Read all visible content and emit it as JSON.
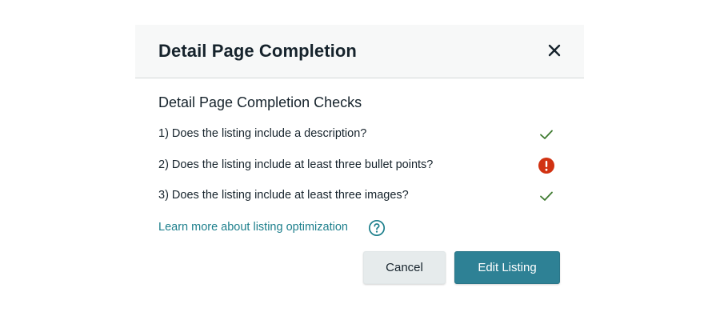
{
  "modal": {
    "title": "Detail Page Completion",
    "close_icon": "close-icon",
    "section_heading": "Detail Page Completion Checks",
    "checks": [
      {
        "label": "1) Does the listing include a description?",
        "status": "pass",
        "icon": "checkmark-icon",
        "color": "#3d7a2f"
      },
      {
        "label": "2) Does the listing include at least three bullet points?",
        "status": "fail",
        "icon": "error-alert-icon",
        "color": "#d13212"
      },
      {
        "label": "3) Does the listing include at least three images?",
        "status": "pass",
        "icon": "checkmark-icon",
        "color": "#3d7a2f"
      }
    ],
    "learn_more_link": "Learn more about listing optimization",
    "help_icon": "help-circle-icon",
    "cancel_label": "Cancel",
    "edit_label": "Edit Listing"
  },
  "colors": {
    "header_bg": "#f7f8f8",
    "link": "#1d7f8c",
    "primary_button": "#2e8195",
    "secondary_button": "#e6ebec"
  }
}
